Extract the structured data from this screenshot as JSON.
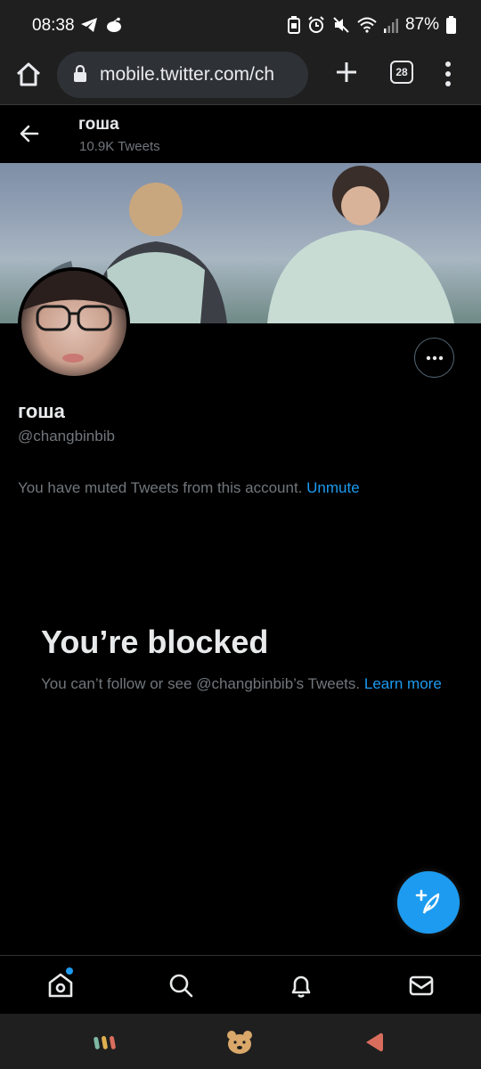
{
  "status_bar": {
    "time": "08:38",
    "battery": "87%",
    "icons": [
      "telegram-icon",
      "reddit-icon",
      "battery-saver-icon",
      "alarm-icon",
      "mute-icon",
      "wifi-icon",
      "signal-icon",
      "battery-icon"
    ]
  },
  "browser": {
    "url": "mobile.twitter.com/ch",
    "tab_count": "28"
  },
  "header": {
    "name": "гоша",
    "tweet_count": "10.9K Tweets"
  },
  "profile": {
    "name": "гоша",
    "handle": "@changbinbib",
    "muted_text": "You have muted Tweets from this account.",
    "unmute_label": "Unmute"
  },
  "blocked": {
    "title": "You’re blocked",
    "description": "You can’t follow or see @changbinbib’s Tweets.",
    "learn_more": "Learn more"
  },
  "colors": {
    "accent": "#1d9bf0",
    "background": "#000000",
    "muted_text": "#71767b"
  }
}
